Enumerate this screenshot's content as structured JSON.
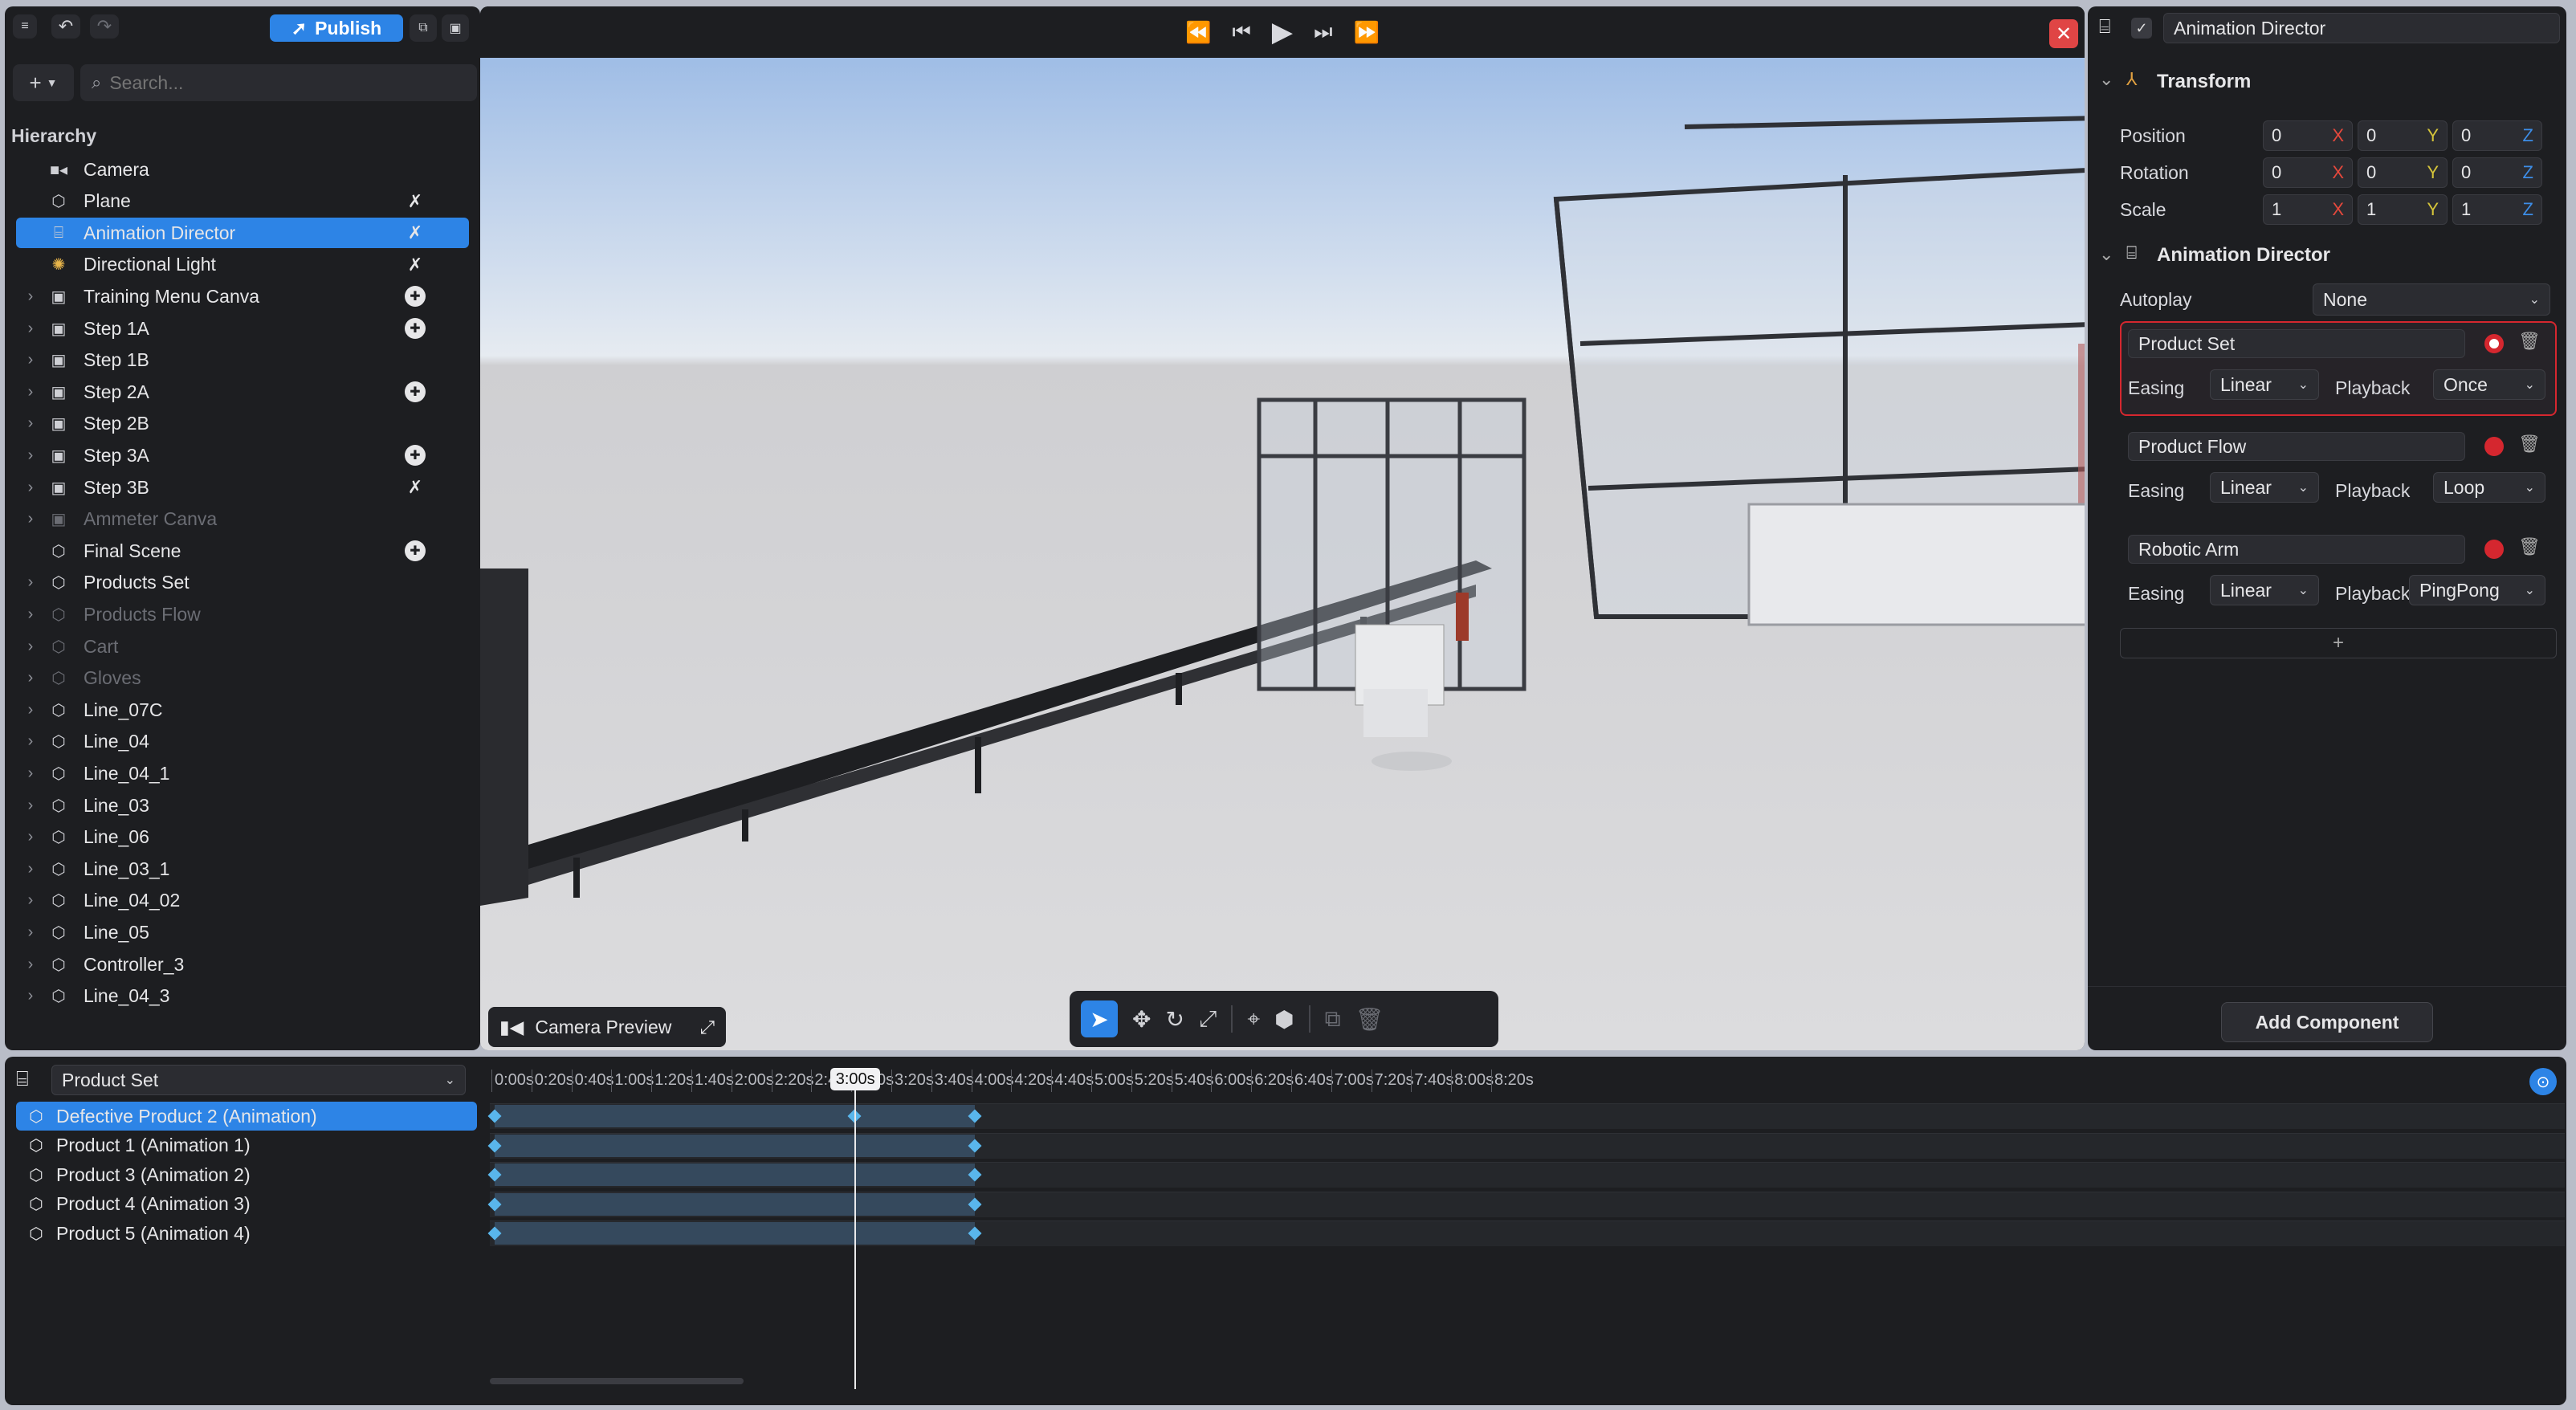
{
  "toolbar": {
    "publish_label": "Publish",
    "add_label": "+",
    "search_placeholder": "Search..."
  },
  "hierarchy": {
    "title": "Hierarchy",
    "items": [
      {
        "label": "Camera",
        "icon": "camera-icon",
        "expandable": false,
        "dim": false,
        "selected": false,
        "badge": ""
      },
      {
        "label": "Plane",
        "icon": "cube-icon",
        "expandable": false,
        "dim": false,
        "selected": false,
        "badge": "hidden"
      },
      {
        "label": "Animation Director",
        "icon": "director-icon",
        "expandable": false,
        "dim": false,
        "selected": true,
        "badge": "hidden"
      },
      {
        "label": "Directional Light",
        "icon": "light-icon",
        "expandable": false,
        "dim": false,
        "selected": false,
        "badge": "hidden"
      },
      {
        "label": "Training Menu Canva",
        "icon": "canvas-icon",
        "expandable": true,
        "dim": false,
        "selected": false,
        "badge": "pin"
      },
      {
        "label": "Step 1A",
        "icon": "canvas-icon",
        "expandable": true,
        "dim": false,
        "selected": false,
        "badge": "pin"
      },
      {
        "label": "Step 1B",
        "icon": "canvas-icon",
        "expandable": true,
        "dim": false,
        "selected": false,
        "badge": ""
      },
      {
        "label": "Step 2A",
        "icon": "canvas-icon",
        "expandable": true,
        "dim": false,
        "selected": false,
        "badge": "pin"
      },
      {
        "label": "Step 2B",
        "icon": "canvas-icon",
        "expandable": true,
        "dim": false,
        "selected": false,
        "badge": ""
      },
      {
        "label": "Step 3A",
        "icon": "canvas-icon",
        "expandable": true,
        "dim": false,
        "selected": false,
        "badge": "pin"
      },
      {
        "label": "Step 3B",
        "icon": "canvas-icon",
        "expandable": true,
        "dim": false,
        "selected": false,
        "badge": "hidden"
      },
      {
        "label": "Ammeter Canva",
        "icon": "canvas-icon",
        "expandable": true,
        "dim": true,
        "selected": false,
        "badge": ""
      },
      {
        "label": "Final Scene",
        "icon": "cube-icon",
        "expandable": false,
        "dim": false,
        "selected": false,
        "badge": "pin"
      },
      {
        "label": "Products Set",
        "icon": "cube-icon",
        "expandable": true,
        "dim": false,
        "selected": false,
        "badge": ""
      },
      {
        "label": "Products Flow",
        "icon": "cube-icon",
        "expandable": true,
        "dim": true,
        "selected": false,
        "badge": ""
      },
      {
        "label": "Cart",
        "icon": "cube-icon",
        "expandable": true,
        "dim": true,
        "selected": false,
        "badge": ""
      },
      {
        "label": "Gloves",
        "icon": "cube-icon",
        "expandable": true,
        "dim": true,
        "selected": false,
        "badge": ""
      },
      {
        "label": "Line_07C",
        "icon": "cube-icon",
        "expandable": true,
        "dim": false,
        "selected": false,
        "badge": ""
      },
      {
        "label": "Line_04",
        "icon": "cube-icon",
        "expandable": true,
        "dim": false,
        "selected": false,
        "badge": ""
      },
      {
        "label": "Line_04_1",
        "icon": "cube-icon",
        "expandable": true,
        "dim": false,
        "selected": false,
        "badge": ""
      },
      {
        "label": "Line_03",
        "icon": "cube-icon",
        "expandable": true,
        "dim": false,
        "selected": false,
        "badge": ""
      },
      {
        "label": "Line_06",
        "icon": "cube-icon",
        "expandable": true,
        "dim": false,
        "selected": false,
        "badge": ""
      },
      {
        "label": "Line_03_1",
        "icon": "cube-icon",
        "expandable": true,
        "dim": false,
        "selected": false,
        "badge": ""
      },
      {
        "label": "Line_04_02",
        "icon": "cube-icon",
        "expandable": true,
        "dim": false,
        "selected": false,
        "badge": ""
      },
      {
        "label": "Line_05",
        "icon": "cube-icon",
        "expandable": true,
        "dim": false,
        "selected": false,
        "badge": ""
      },
      {
        "label": "Controller_3",
        "icon": "cube-icon",
        "expandable": true,
        "dim": false,
        "selected": false,
        "badge": ""
      },
      {
        "label": "Line_04_3",
        "icon": "cube-icon",
        "expandable": true,
        "dim": false,
        "selected": false,
        "badge": ""
      }
    ]
  },
  "viewport": {
    "camera_preview_label": "Camera Preview",
    "transport": [
      "skip-back-icon",
      "step-back-icon",
      "play-icon",
      "step-forward-icon",
      "fast-forward-icon"
    ],
    "tools": [
      "select-icon",
      "move-icon",
      "rotate-icon",
      "scale-icon",
      "pivot-icon",
      "cube-view-icon",
      "duplicate-icon",
      "delete-icon"
    ]
  },
  "inspector": {
    "object_name": "Animation Director",
    "transform": {
      "title": "Transform",
      "rows": [
        {
          "label": "Position",
          "x": "0",
          "y": "0",
          "z": "0"
        },
        {
          "label": "Rotation",
          "x": "0",
          "y": "0",
          "z": "0"
        },
        {
          "label": "Scale",
          "x": "1",
          "y": "1",
          "z": "1"
        }
      ],
      "axis_letters": {
        "x": "X",
        "y": "Y",
        "z": "Z"
      }
    },
    "director": {
      "title": "Animation Director",
      "autoplay_label": "Autoplay",
      "autoplay_value": "None",
      "easing_label": "Easing",
      "playback_label": "Playback",
      "animations": [
        {
          "name": "Product Set",
          "easing": "Linear",
          "playback": "Once",
          "active": true
        },
        {
          "name": "Product Flow",
          "easing": "Linear",
          "playback": "Loop",
          "active": false
        },
        {
          "name": "Robotic Arm",
          "easing": "Linear",
          "playback": "PingPong",
          "active": false
        }
      ],
      "add_label": "+"
    },
    "add_component_label": "Add Component"
  },
  "timeline": {
    "selected_animation": "Product Set",
    "tracks": [
      {
        "label": "Defective Product 2 (Animation)",
        "selected": true
      },
      {
        "label": "Product 1 (Animation 1)",
        "selected": false
      },
      {
        "label": "Product 3 (Animation 2)",
        "selected": false
      },
      {
        "label": "Product 4 (Animation 3)",
        "selected": false
      },
      {
        "label": "Product 5 (Animation 4)",
        "selected": false
      }
    ],
    "ticks": [
      "0:00s",
      "0:20s",
      "0:40s",
      "1:00s",
      "1:20s",
      "1:40s",
      "2:00s",
      "2:20s",
      "2:40s",
      "3:00s",
      "3:20s",
      "3:40s",
      "4:00s",
      "4:20s",
      "4:40s",
      "5:00s",
      "5:20s",
      "5:40s",
      "6:00s",
      "6:20s",
      "6:40s",
      "7:00s",
      "7:20s",
      "7:40s",
      "8:00s",
      "8:20s"
    ],
    "playhead_label": "3:00s",
    "playhead_seconds": 180,
    "clip_end_seconds": 240,
    "keyframe_seconds": [
      0,
      180,
      240
    ]
  },
  "colors": {
    "accent": "#2d84e6",
    "record": "#d5272f",
    "sky_top": "#a9c3e8"
  }
}
